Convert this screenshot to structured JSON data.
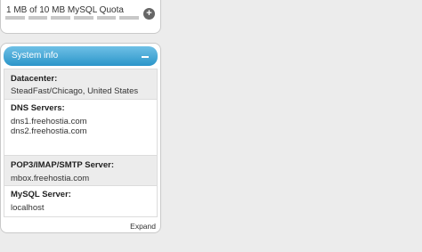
{
  "quota": {
    "text": "1 MB of 10 MB MySQL Quota",
    "usage_fraction": 0.1
  },
  "system_info": {
    "title": "System info",
    "datacenter": {
      "label": "Datacenter:",
      "value": "SteadFast/Chicago, United States"
    },
    "dns": {
      "label": "DNS Servers:",
      "values": [
        "dns1.freehostia.com",
        "dns2.freehostia.com"
      ]
    },
    "mail": {
      "label": "POP3/IMAP/SMTP Server:",
      "value": "mbox.freehostia.com"
    },
    "mysql": {
      "label": "MySQL Server:",
      "value": "localhost"
    },
    "expand_label": "Expand"
  },
  "colors": {
    "header_top": "#6fc0e6",
    "header_bottom": "#2b95c9",
    "background": "#ececec"
  }
}
